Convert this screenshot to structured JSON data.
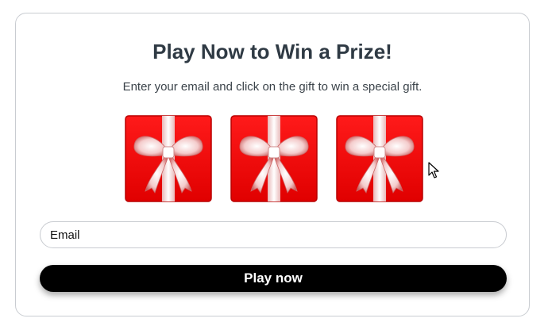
{
  "header": {
    "title": "Play Now to Win a Prize!",
    "subtitle": "Enter your email and click on the gift to win a special gift."
  },
  "gifts": [
    {
      "icon": "gift-box-icon"
    },
    {
      "icon": "gift-box-icon"
    },
    {
      "icon": "gift-box-icon"
    }
  ],
  "form": {
    "email_placeholder": "Email",
    "email_value": "",
    "play_label": "Play now"
  },
  "colors": {
    "gift_red": "#ff0000",
    "ribbon": "#f2c9c9",
    "button_bg": "#000000",
    "title_text": "#2f3a44"
  }
}
